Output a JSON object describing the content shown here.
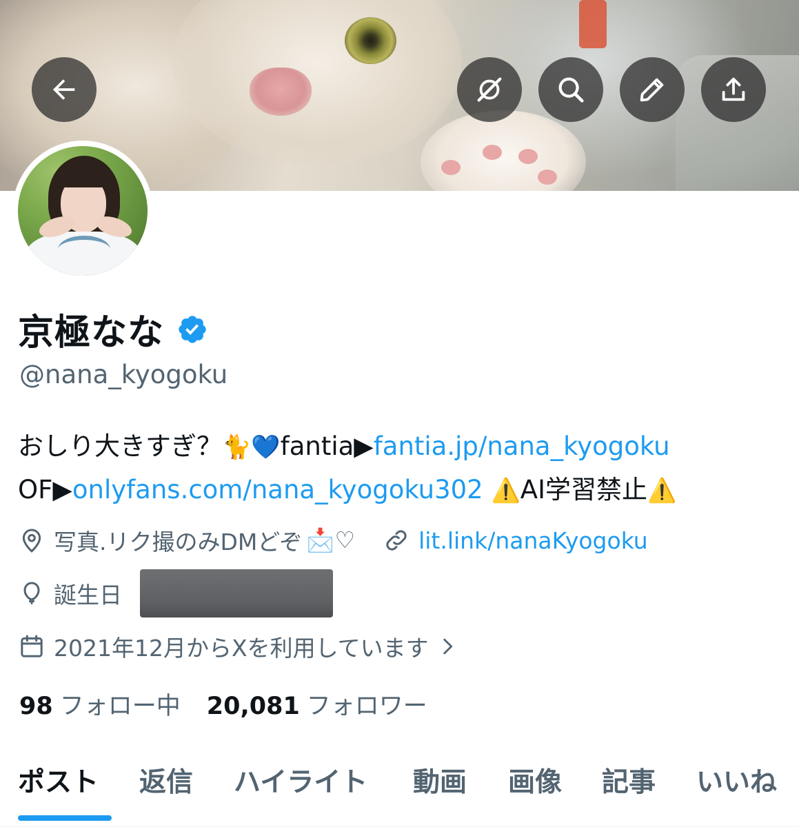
{
  "banner": {
    "description_icon_names": [
      "back-arrow-icon",
      "grok-icon",
      "search-icon",
      "pencil-icon",
      "share-icon"
    ]
  },
  "profile": {
    "name": "京極なな",
    "handle": "@nana_kyogoku",
    "bio_line1_text1": "おしり大きすぎ？",
    "bio_line1_emoji": "🐈💙",
    "bio_line1_text2": "fantia▶",
    "bio_line1_link": "fantia.jp/nana_kyogoku",
    "bio_line2_text1": "OF▶",
    "bio_line2_link": "onlyfans.com/nana_kyogoku302",
    "bio_line2_warn1": "⚠️",
    "bio_line2_text2": "AI学習禁止",
    "bio_line2_warn2": "⚠️",
    "location": "写真.リク撮のみDMどぞ",
    "location_emoji": "📩♡",
    "website": "lit.link/nanaKyogoku",
    "birthday_label": "誕生日",
    "joined": "2021年12月からXを利用しています",
    "following_count": "98",
    "following_label": "フォロー中",
    "followers_count": "20,081",
    "followers_label": "フォロワー"
  },
  "tabs": [
    "ポスト",
    "返信",
    "ハイライト",
    "動画",
    "画像",
    "記事",
    "いいね"
  ],
  "active_tab": "ポスト",
  "colors": {
    "accent": "#1d9bf0",
    "secondary_text": "#536471",
    "primary_text": "#0f1419",
    "verified": "#1d9bf0"
  }
}
